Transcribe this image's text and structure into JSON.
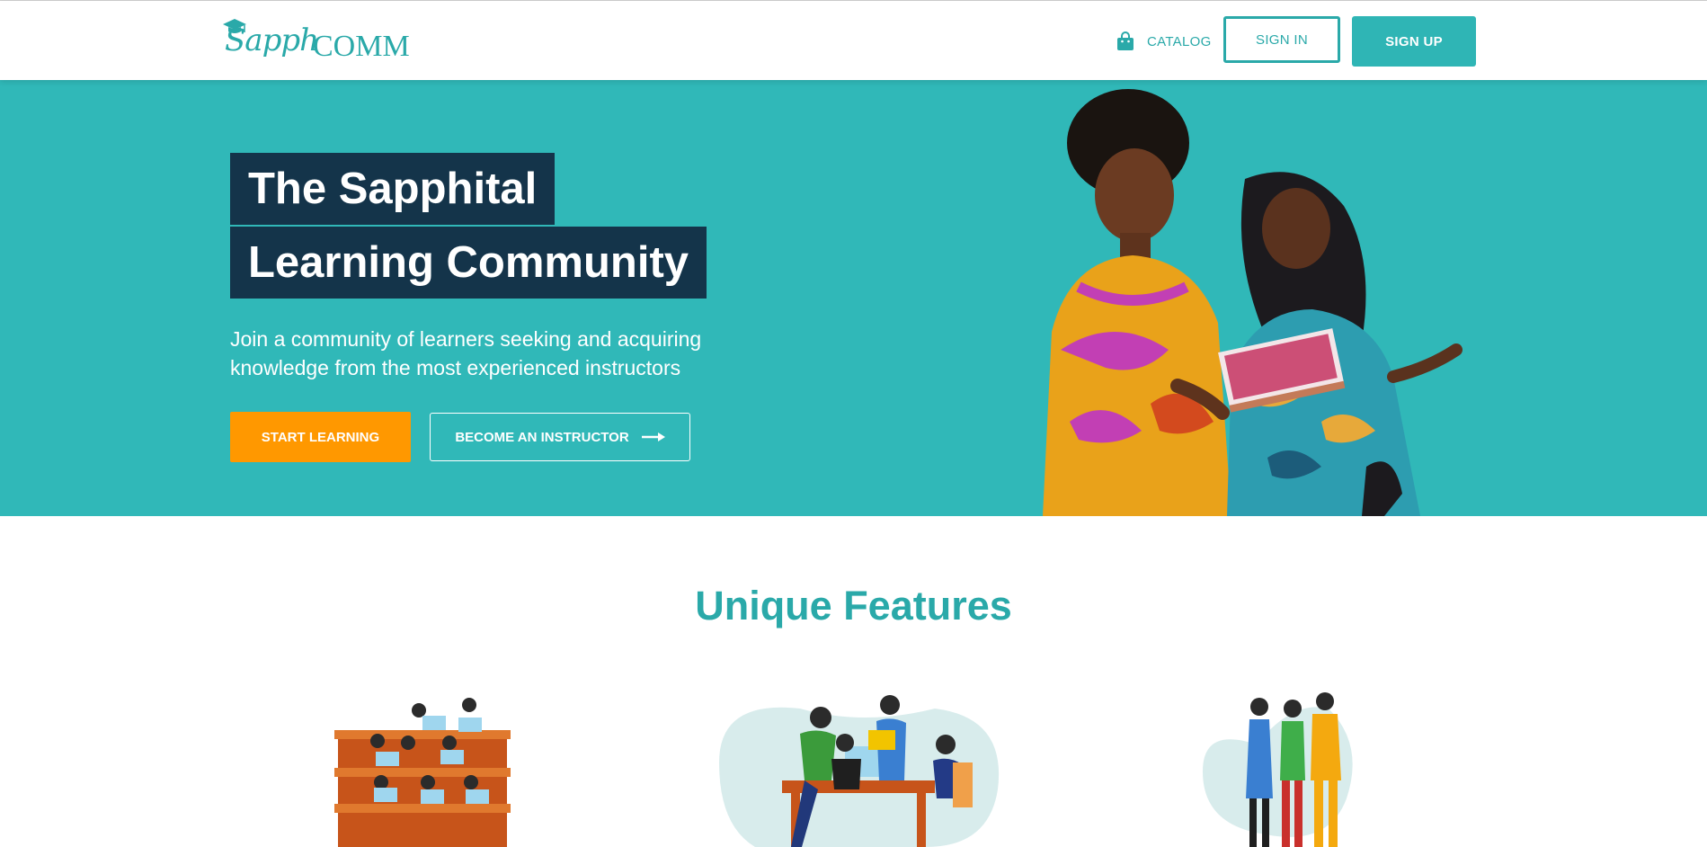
{
  "nav": {
    "logo_script": "Sapph",
    "logo_caps": "COMM",
    "catalog_label": "CATALOG",
    "sign_in_label": "SIGN IN",
    "sign_up_label": "SIGN UP",
    "catalog_icon": "shopping-bag-icon",
    "logo_icon": "graduation-cap-icon"
  },
  "hero": {
    "title_line1": "The Sapphital",
    "title_line2": "Learning Community",
    "subtitle": "Join a community of learners seeking and acquiring knowledge from the most experienced instructors",
    "start_label": "START LEARNING",
    "instructor_label": "BECOME AN INSTRUCTOR",
    "instructor_icon": "arrow-right-icon"
  },
  "features": {
    "title": "Unique Features"
  },
  "colors": {
    "brand_teal": "#2fb5b5",
    "hero_bg": "#30b8b8",
    "title_bg": "#14344a",
    "accent_orange": "#ff9800"
  }
}
